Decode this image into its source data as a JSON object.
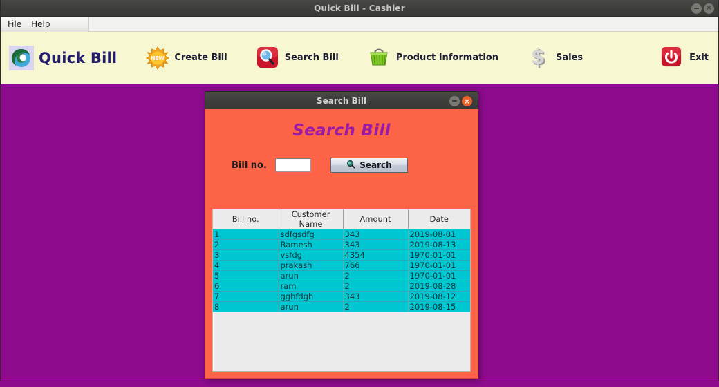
{
  "window": {
    "title": "Quick Bill - Cashier",
    "minimize_label": "minimize",
    "close_label": "×"
  },
  "menubar": {
    "items": [
      {
        "label": "File",
        "name": "menu-file"
      },
      {
        "label": "Help",
        "name": "menu-help"
      }
    ]
  },
  "toolbar": {
    "brand": {
      "label": "Quick Bill",
      "icon": "quickbill-logo-icon"
    },
    "items": [
      {
        "label": "Create Bill",
        "icon": "new-starburst-icon"
      },
      {
        "label": "Search Bill",
        "icon": "magnifier-red-icon"
      },
      {
        "label": "Product Information",
        "icon": "shopping-basket-icon"
      },
      {
        "label": "Sales",
        "icon": "dollar-sign-icon"
      }
    ],
    "exit": {
      "label": "Exit",
      "icon": "power-off-icon"
    }
  },
  "dialog": {
    "title": "Search Bill",
    "heading": "Search Bill",
    "minimize_label": "minimize",
    "close_label": "×",
    "form": {
      "bill_no_label": "Bill no.",
      "bill_no_value": "",
      "bill_no_placeholder": "",
      "search_button_label": "Search",
      "search_button_icon": "magnifier-icon"
    },
    "table": {
      "columns": [
        "Bill no.",
        "Customer Name",
        "Amount",
        "Date"
      ],
      "rows": [
        [
          "1",
          "sdfgsdfg",
          "343",
          "2019-08-01"
        ],
        [
          "2",
          "Ramesh",
          "343",
          "2019-08-13"
        ],
        [
          "3",
          "vsfdg",
          "4354",
          "1970-01-01"
        ],
        [
          "4",
          "prakash",
          "766",
          "1970-01-01"
        ],
        [
          "5",
          "arun",
          "2",
          "1970-01-01"
        ],
        [
          "6",
          "ram",
          "2",
          "2019-08-28"
        ],
        [
          "7",
          "gghfdgh",
          "343",
          "2019-08-12"
        ],
        [
          "8",
          "arun",
          "2",
          "2019-08-15"
        ]
      ]
    }
  },
  "colors": {
    "desktop": "#8e0b8e",
    "toolbar": "#f7f7d2",
    "dialog_body": "#fc6347",
    "heading": "#9c1ba6",
    "table_row": "#00c8d2",
    "titlebar": "#3d3d3a",
    "close_button": "#e8622e"
  }
}
